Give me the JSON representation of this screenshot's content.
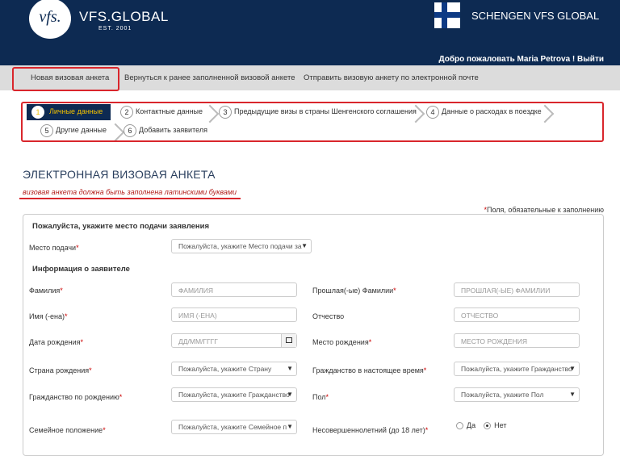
{
  "header": {
    "logo_text": "vfs.",
    "brand": "VFS.GLOBAL",
    "est": "EST. 2001",
    "title": "SCHENGEN VFS GLOBAL",
    "welcome": "Добро пожаловать Maria Petrova ! Выйти",
    "flag": "finland-flag-icon"
  },
  "nav": {
    "items": [
      "Новая визовая анкета",
      "Вернуться к ранее заполненной визовой анкете",
      "Отправить визовую анкету по электронной почте"
    ]
  },
  "steps": [
    {
      "num": "1",
      "label": "Личные данные",
      "active": true
    },
    {
      "num": "2",
      "label": "Контактные данные"
    },
    {
      "num": "3",
      "label": "Предыдущие визы в страны Шенгенского соглашения"
    },
    {
      "num": "4",
      "label": "Данные о расходах в поездке"
    },
    {
      "num": "5",
      "label": "Другие данные"
    },
    {
      "num": "6",
      "label": "Добавить заявителя"
    }
  ],
  "page": {
    "title": "ЭЛЕКТРОННАЯ ВИЗОВАЯ АНКЕТА",
    "note": "визовая анкета должна быть заполнена латинскими буквами",
    "required_note": "Поля, обязательные к заполнению"
  },
  "form": {
    "section1": "Пожалуйста, укажите место подачи заявления",
    "section2": "Информация о заявителе",
    "place_label": "Место подачи",
    "place_value": "Пожалуйста, укажите Место подачи за",
    "surname_label": "Фамилия",
    "surname_ph": "ФАМИЛИЯ",
    "prev_surname_label": "Прошлая(-ые) Фамилии",
    "prev_surname_ph": "ПРОШЛАЯ(-ЫЕ) ФАМИЛИИ",
    "name_label": "Имя (-ена)",
    "name_ph": "ИМЯ (-ЕНА)",
    "patronymic_label": "Отчество",
    "patronymic_ph": "ОТЧЕСТВО",
    "dob_label": "Дата рождения",
    "dob_ph": "ДД/ММ/ГГГГ",
    "pob_label": "Место рождения",
    "pob_ph": "МЕСТО РОЖДЕНИЯ",
    "country_birth_label": "Страна рождения",
    "country_birth_value": "Пожалуйста, укажите Страну",
    "current_cit_label": "Гражданство в настоящее время",
    "current_cit_value": "Пожалуйста, укажите Гражданство",
    "birth_cit_label": "Гражданство по рождению",
    "birth_cit_value": "Пожалуйста, укажите Гражданство",
    "sex_label": "Пол",
    "sex_value": "Пожалуйста, укажите Пол",
    "marital_label": "Семейное положение",
    "marital_value": "Пожалуйста, укажите Семейное п",
    "minor_label": "Несовершеннолетний (до 18 лет)",
    "minor_yes": "Да",
    "minor_no": "Нет",
    "minor_selected": "Нет"
  },
  "colors": {
    "header_bg": "#0d2a52",
    "highlight_red": "#d9262c",
    "active_step_text": "#f0c000"
  }
}
